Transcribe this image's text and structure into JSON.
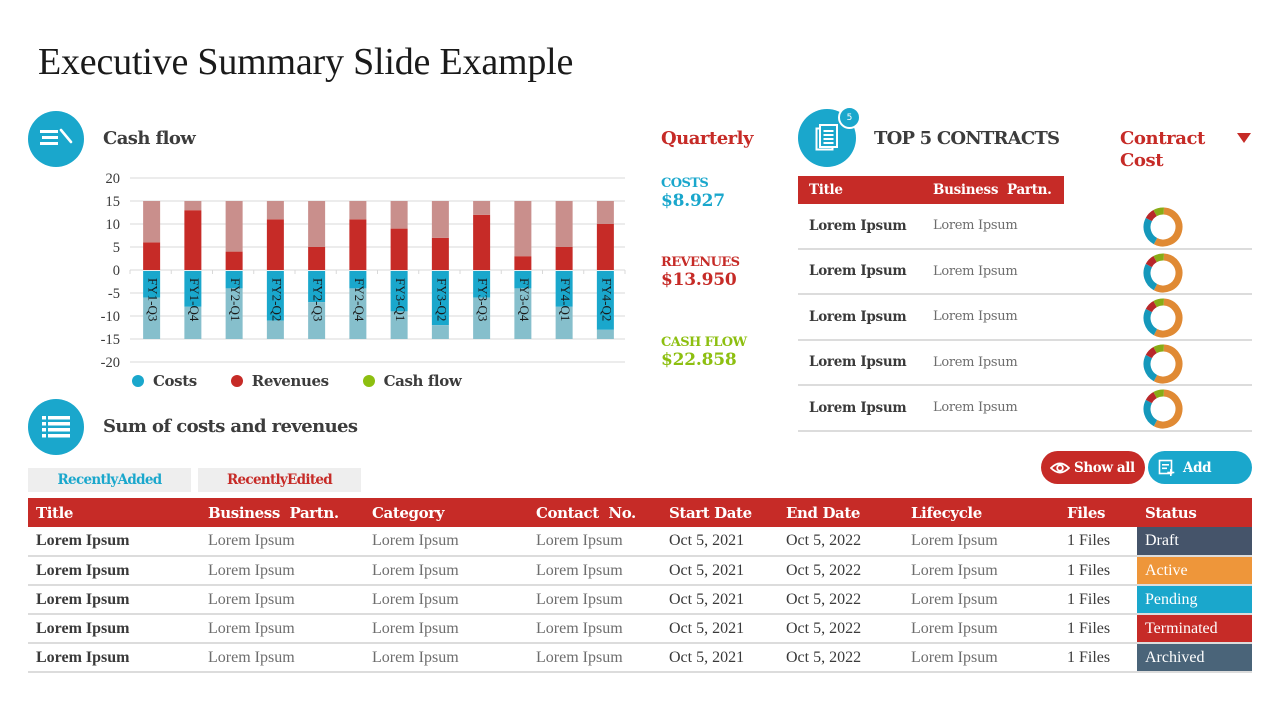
{
  "page_title": "Executive Summary Slide Example",
  "cashflow": {
    "title": "Cash flow",
    "icon": "pen-lines-icon",
    "legend": [
      {
        "label": "Costs",
        "color": "#1aa7cc"
      },
      {
        "label": "Revenues",
        "color": "#c62b27"
      },
      {
        "label": "Cash flow",
        "color": "#8dbf10"
      }
    ]
  },
  "chart_data": {
    "type": "bar",
    "stacked": true,
    "title": "Cash flow",
    "xlabel": "",
    "ylabel": "",
    "categories": [
      "FY1-Q3",
      "FY1-Q4",
      "FY2-Q1",
      "FY2-Q2",
      "FY2-Q3",
      "FY2-Q4",
      "FY3-Q1",
      "FY3-Q2",
      "FY3-Q3",
      "FY3-Q4",
      "FY4-Q1",
      "FY4-Q2"
    ],
    "series": [
      {
        "name": "Revenues",
        "color": "#c62b27",
        "values": [
          6,
          13,
          4,
          11,
          5,
          11,
          9,
          7,
          12,
          3,
          5,
          10
        ]
      },
      {
        "name": "Revenues (remaining to 15)",
        "color": "#c98f8c",
        "values": [
          9,
          2,
          11,
          4,
          10,
          4,
          6,
          8,
          3,
          12,
          10,
          5
        ]
      },
      {
        "name": "Costs",
        "color": "#1aa7cc",
        "values": [
          -6,
          -8,
          -4,
          -11,
          -7,
          -4,
          -9,
          -12,
          -6,
          -4,
          -8,
          -13
        ]
      },
      {
        "name": "Costs (remaining to -15)",
        "color": "#86bfcc",
        "values": [
          -9,
          -7,
          -11,
          -4,
          -8,
          -11,
          -6,
          -3,
          -9,
          -11,
          -7,
          -2
        ]
      }
    ],
    "yticks": [
      20,
      15,
      10,
      5,
      0,
      -5,
      -10,
      -15,
      -20
    ],
    "ylim": [
      -20,
      20
    ],
    "grid": true,
    "legend": [
      "Costs",
      "Revenues",
      "Cash flow"
    ],
    "legend_position": "bottom"
  },
  "quarterly": {
    "title": "Quarterly",
    "items": [
      {
        "label": "COSTS",
        "value": "$8.927",
        "color": "#1aa7cc"
      },
      {
        "label": "REVENUES",
        "value": "$13.950",
        "color": "#c62b27"
      },
      {
        "label": "CASH FLOW",
        "value": "$22.858",
        "color": "#8dbf10"
      }
    ]
  },
  "contracts": {
    "title": "TOP 5 CONTRACTS",
    "badge": "5",
    "cost_label": "Contract Cost",
    "headers": [
      "Title",
      "Business  Partn."
    ],
    "donut_segments": [
      {
        "name": "orange",
        "color": "#e08a34",
        "value": 57
      },
      {
        "name": "blue",
        "color": "#1598bb",
        "value": 25
      },
      {
        "name": "red",
        "color": "#b8282a",
        "value": 9
      },
      {
        "name": "green",
        "color": "#88ab16",
        "value": 9
      }
    ],
    "rows": [
      {
        "title": "Lorem Ipsum",
        "partner": "Lorem Ipsum"
      },
      {
        "title": "Lorem Ipsum",
        "partner": "Lorem Ipsum"
      },
      {
        "title": "Lorem Ipsum",
        "partner": "Lorem Ipsum"
      },
      {
        "title": "Lorem Ipsum",
        "partner": "Lorem Ipsum"
      },
      {
        "title": "Lorem Ipsum",
        "partner": "Lorem Ipsum"
      }
    ]
  },
  "summary": {
    "title": "Sum of costs and revenues",
    "tabs": [
      {
        "label": "RecentlyAdded",
        "color": "#1aa7cc"
      },
      {
        "label": "RecentlyEdited",
        "color": "#c62b27"
      }
    ],
    "buttons": {
      "show_all": "Show all",
      "add": "Add"
    },
    "headers": [
      "Title",
      "Business  Partn.",
      "Category",
      "Contact  No.",
      "Start Date",
      "End Date",
      "Lifecycle",
      "Files",
      "Status"
    ],
    "rows": [
      {
        "title": "Lorem Ipsum",
        "partner": "Lorem Ipsum",
        "category": "Lorem Ipsum",
        "contact": "Lorem Ipsum",
        "start": "Oct 5, 2021",
        "end": "Oct 5, 2022",
        "lifecycle": "Lorem Ipsum",
        "files": "1 Files",
        "status": "Draft",
        "status_color": "#45546a"
      },
      {
        "title": "Lorem Ipsum",
        "partner": "Lorem Ipsum",
        "category": "Lorem Ipsum",
        "contact": "Lorem Ipsum",
        "start": "Oct 5, 2021",
        "end": "Oct 5, 2022",
        "lifecycle": "Lorem Ipsum",
        "files": "1 Files",
        "status": "Active",
        "status_color": "#ee963a"
      },
      {
        "title": "Lorem Ipsum",
        "partner": "Lorem Ipsum",
        "category": "Lorem Ipsum",
        "contact": "Lorem Ipsum",
        "start": "Oct 5, 2021",
        "end": "Oct 5, 2022",
        "lifecycle": "Lorem Ipsum",
        "files": "1 Files",
        "status": "Pending",
        "status_color": "#1aa7cc"
      },
      {
        "title": "Lorem Ipsum",
        "partner": "Lorem Ipsum",
        "category": "Lorem Ipsum",
        "contact": "Lorem Ipsum",
        "start": "Oct 5, 2021",
        "end": "Oct 5, 2022",
        "lifecycle": "Lorem Ipsum",
        "files": "1 Files",
        "status": "Terminated",
        "status_color": "#c62b27"
      },
      {
        "title": "Lorem Ipsum",
        "partner": "Lorem Ipsum",
        "category": "Lorem Ipsum",
        "contact": "Lorem Ipsum",
        "start": "Oct 5, 2021",
        "end": "Oct 5, 2022",
        "lifecycle": "Lorem Ipsum",
        "files": "1 Files",
        "status": "Archived",
        "status_color": "#4a6479"
      }
    ]
  },
  "colors": {
    "accent_blue": "#1aa7cc",
    "accent_red": "#c62b27",
    "accent_green": "#8dbf10"
  }
}
